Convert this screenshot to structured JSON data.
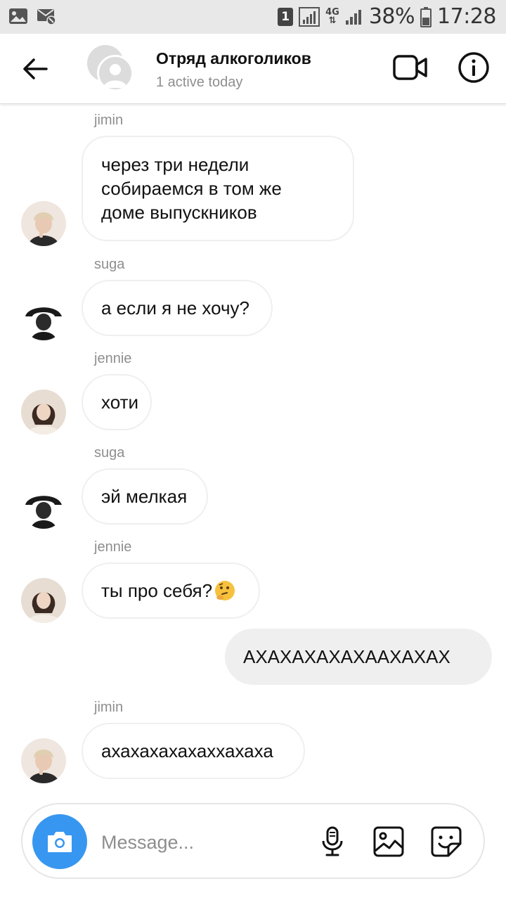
{
  "status_bar": {
    "sim": "1",
    "network": "4G",
    "battery": "38%",
    "time": "17:28"
  },
  "header": {
    "title": "Отряд алкоголиков",
    "subtitle": "1 active today"
  },
  "messages": [
    {
      "sender": "jimin",
      "text_lines": [
        "через три недели",
        "собираемся в том же",
        "доме выпускников"
      ]
    },
    {
      "sender": "suga",
      "text": "а если я не хочу?"
    },
    {
      "sender": "jennie",
      "text": "хоти"
    },
    {
      "sender": "suga",
      "text": "эй мелкая"
    },
    {
      "sender": "jennie",
      "text": "ты про себя?",
      "emoji": "🤔"
    },
    {
      "outgoing": true,
      "text": "АХАХАХАХАХААХАХАХ"
    },
    {
      "sender": "jimin",
      "text": "ахахахахахаххахаха"
    }
  ],
  "composer": {
    "placeholder": "Message..."
  },
  "colors": {
    "accent": "#3797f0",
    "status_bar_bg": "#e8e8e8",
    "incoming_bubble_border": "#efefef",
    "outgoing_bubble_bg": "#efefef",
    "secondary_text": "#8e8e8e"
  },
  "icons": [
    "gallery-icon",
    "sms-blocked-icon",
    "signal-icon",
    "battery-icon",
    "back-arrow-icon",
    "video-camera-icon",
    "info-icon",
    "camera-icon",
    "microphone-icon",
    "image-icon",
    "sticker-icon"
  ]
}
